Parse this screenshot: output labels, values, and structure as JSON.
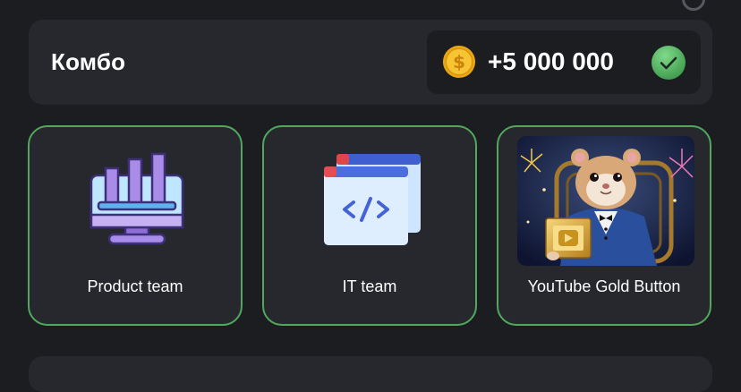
{
  "combo": {
    "title": "Комбо",
    "reward": "+5 000 000",
    "coin_icon": "gold-coin-icon",
    "status_icon": "check-circle-icon",
    "status": "completed"
  },
  "cards": [
    {
      "label": "Product team",
      "icon": "dashboard-chart-icon"
    },
    {
      "label": "IT team",
      "icon": "code-window-icon"
    },
    {
      "label": "YouTube Gold Button",
      "icon": "hamster-gold-button-image"
    }
  ],
  "colors": {
    "background": "#1c1d21",
    "panel": "#26282d",
    "card_border": "#51a85c",
    "check": "#5fc16b",
    "coin": "#f4c430"
  }
}
